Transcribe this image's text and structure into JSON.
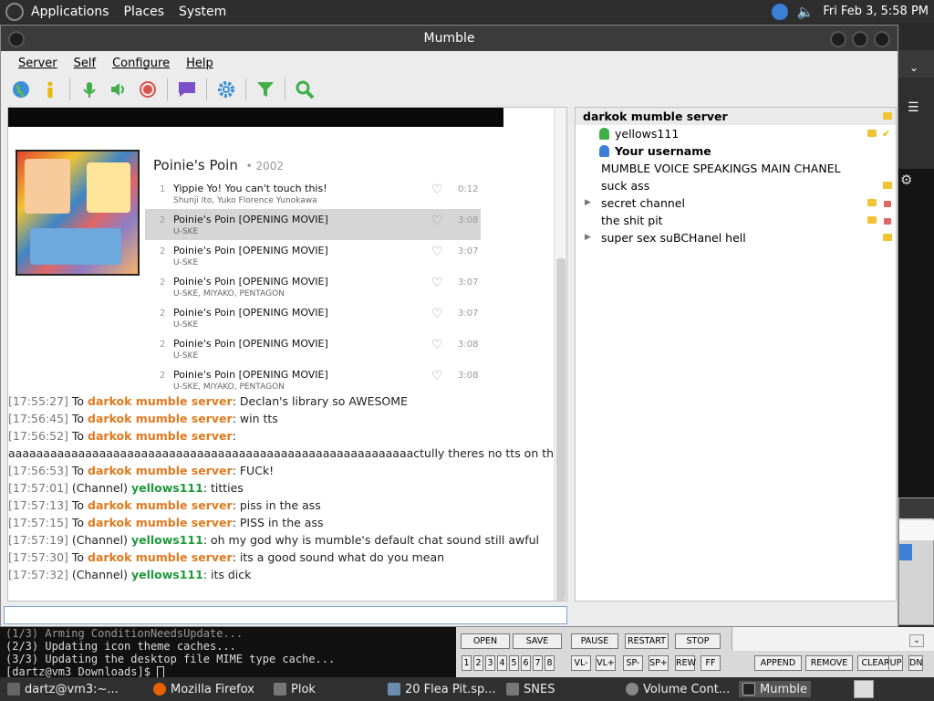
{
  "topbar": {
    "menu": [
      "Applications",
      "Places",
      "System"
    ],
    "datetime": "Fri Feb  3,  5:58 PM"
  },
  "window": {
    "title": "Mumble"
  },
  "menu": {
    "items": [
      "Server",
      "Self",
      "Configure",
      "Help"
    ]
  },
  "toolbar": {
    "icons": [
      "globe-icon",
      "info-icon",
      "microphone-icon",
      "speaker-icon",
      "record-icon",
      "chat-icon",
      "gear-icon",
      "filter-icon",
      "search-icon"
    ]
  },
  "media": {
    "album_title": "Poinie's Poin",
    "album_year": "2002",
    "tracks": [
      {
        "num": "1",
        "title": "Yippie Yo! You can't touch this!",
        "artist": "Shunji Ito, Yuko Florence Yunokawa",
        "duration": "0:12"
      },
      {
        "num": "2",
        "title": "Poinie's Poin [OPENING MOVIE]",
        "artist": "U-SKE",
        "duration": "3:08"
      },
      {
        "num": "2",
        "title": "Poinie's Poin [OPENING MOVIE]",
        "artist": "U-SKE",
        "duration": "3:07"
      },
      {
        "num": "2",
        "title": "Poinie's Poin [OPENING MOVIE]",
        "artist": "U-SKE, MIYAKO, PENTAGON",
        "duration": "3:07"
      },
      {
        "num": "2",
        "title": "Poinie's Poin [OPENING MOVIE]",
        "artist": "U-SKE",
        "duration": "3:07"
      },
      {
        "num": "2",
        "title": "Poinie's Poin [OPENING MOVIE]",
        "artist": "U-SKE",
        "duration": "3:08"
      },
      {
        "num": "2",
        "title": "Poinie's Poin [OPENING MOVIE]",
        "artist": "U-SKE, MIYAKO, PENTAGON",
        "duration": "3:08"
      }
    ]
  },
  "chat": [
    {
      "ts": "[17:55:27]",
      "pre": " To ",
      "who": "darkok mumble server",
      "kind": "srv",
      "msg": ": Declan's library so AWESOME"
    },
    {
      "ts": "[17:56:45]",
      "pre": " To ",
      "who": "darkok mumble server",
      "kind": "srv",
      "msg": ": win tts"
    },
    {
      "ts": "[17:56:52]",
      "pre": " To ",
      "who": "darkok mumble server",
      "kind": "srv",
      "msg": ":"
    },
    {
      "ts": "",
      "pre": "",
      "who": "",
      "kind": "",
      "msg": "aaaaaaaaaaaaaaaaaaaaaaaaaaaaaaaaaaaaaaaaaaaaaaaaaaaaaaaaaactully theres no tts on this"
    },
    {
      "ts": "[17:56:53]",
      "pre": " To ",
      "who": "darkok mumble server",
      "kind": "srv",
      "msg": ": FUCk!"
    },
    {
      "ts": "[17:57:01]",
      "pre": " (Channel) ",
      "who": "yellows111",
      "kind": "usr",
      "msg": ": titties"
    },
    {
      "ts": "[17:57:13]",
      "pre": " To ",
      "who": "darkok mumble server",
      "kind": "srv",
      "msg": ": piss in the ass"
    },
    {
      "ts": "[17:57:15]",
      "pre": " To ",
      "who": "darkok mumble server",
      "kind": "srv",
      "msg": ": PISS in the ass"
    },
    {
      "ts": "[17:57:19]",
      "pre": " (Channel) ",
      "who": "yellows111",
      "kind": "usr",
      "msg": ": oh my god why is mumble's default chat sound still awful"
    },
    {
      "ts": "[17:57:30]",
      "pre": " To ",
      "who": "darkok mumble server",
      "kind": "srv",
      "msg": ": its a good sound what do you mean"
    },
    {
      "ts": "[17:57:32]",
      "pre": " (Channel) ",
      "who": "yellows111",
      "kind": "usr",
      "msg": ": its dick"
    }
  ],
  "tree": {
    "server": "darkok mumble server",
    "user1": "yellows111",
    "user2": "Your username",
    "channels": [
      "MUMBLE VOICE SPEAKINGS MAIN CHANEL",
      "suck ass",
      "secret channel",
      "the shit pit",
      "super sex suBCHanel hell"
    ]
  },
  "terminal": {
    "lines": [
      "(1/3) Arming ConditionNeedsUpdate...",
      "(2/3) Updating icon theme caches...",
      "(3/3) Updating the desktop file MIME type cache...",
      "[dartz@vm3 Downloads]$ "
    ]
  },
  "controls": {
    "row1": [
      "OPEN",
      "SAVE",
      "PAUSE",
      "RESTART",
      "STOP"
    ],
    "nums": [
      "1",
      "2",
      "3",
      "4",
      "5",
      "6",
      "7",
      "8"
    ],
    "row2": [
      "VL-",
      "VL+",
      "SP-",
      "SP+",
      "REW",
      "FF",
      "APPEND",
      "REMOVE",
      "CLEAR",
      "UP",
      "DN"
    ]
  },
  "taskbar": {
    "items": [
      "dartz@vm3:~...",
      "Mozilla Firefox",
      "Plok",
      "20 Flea Pit.sp...",
      "SNES",
      "Volume Cont...",
      "Mumble"
    ]
  }
}
